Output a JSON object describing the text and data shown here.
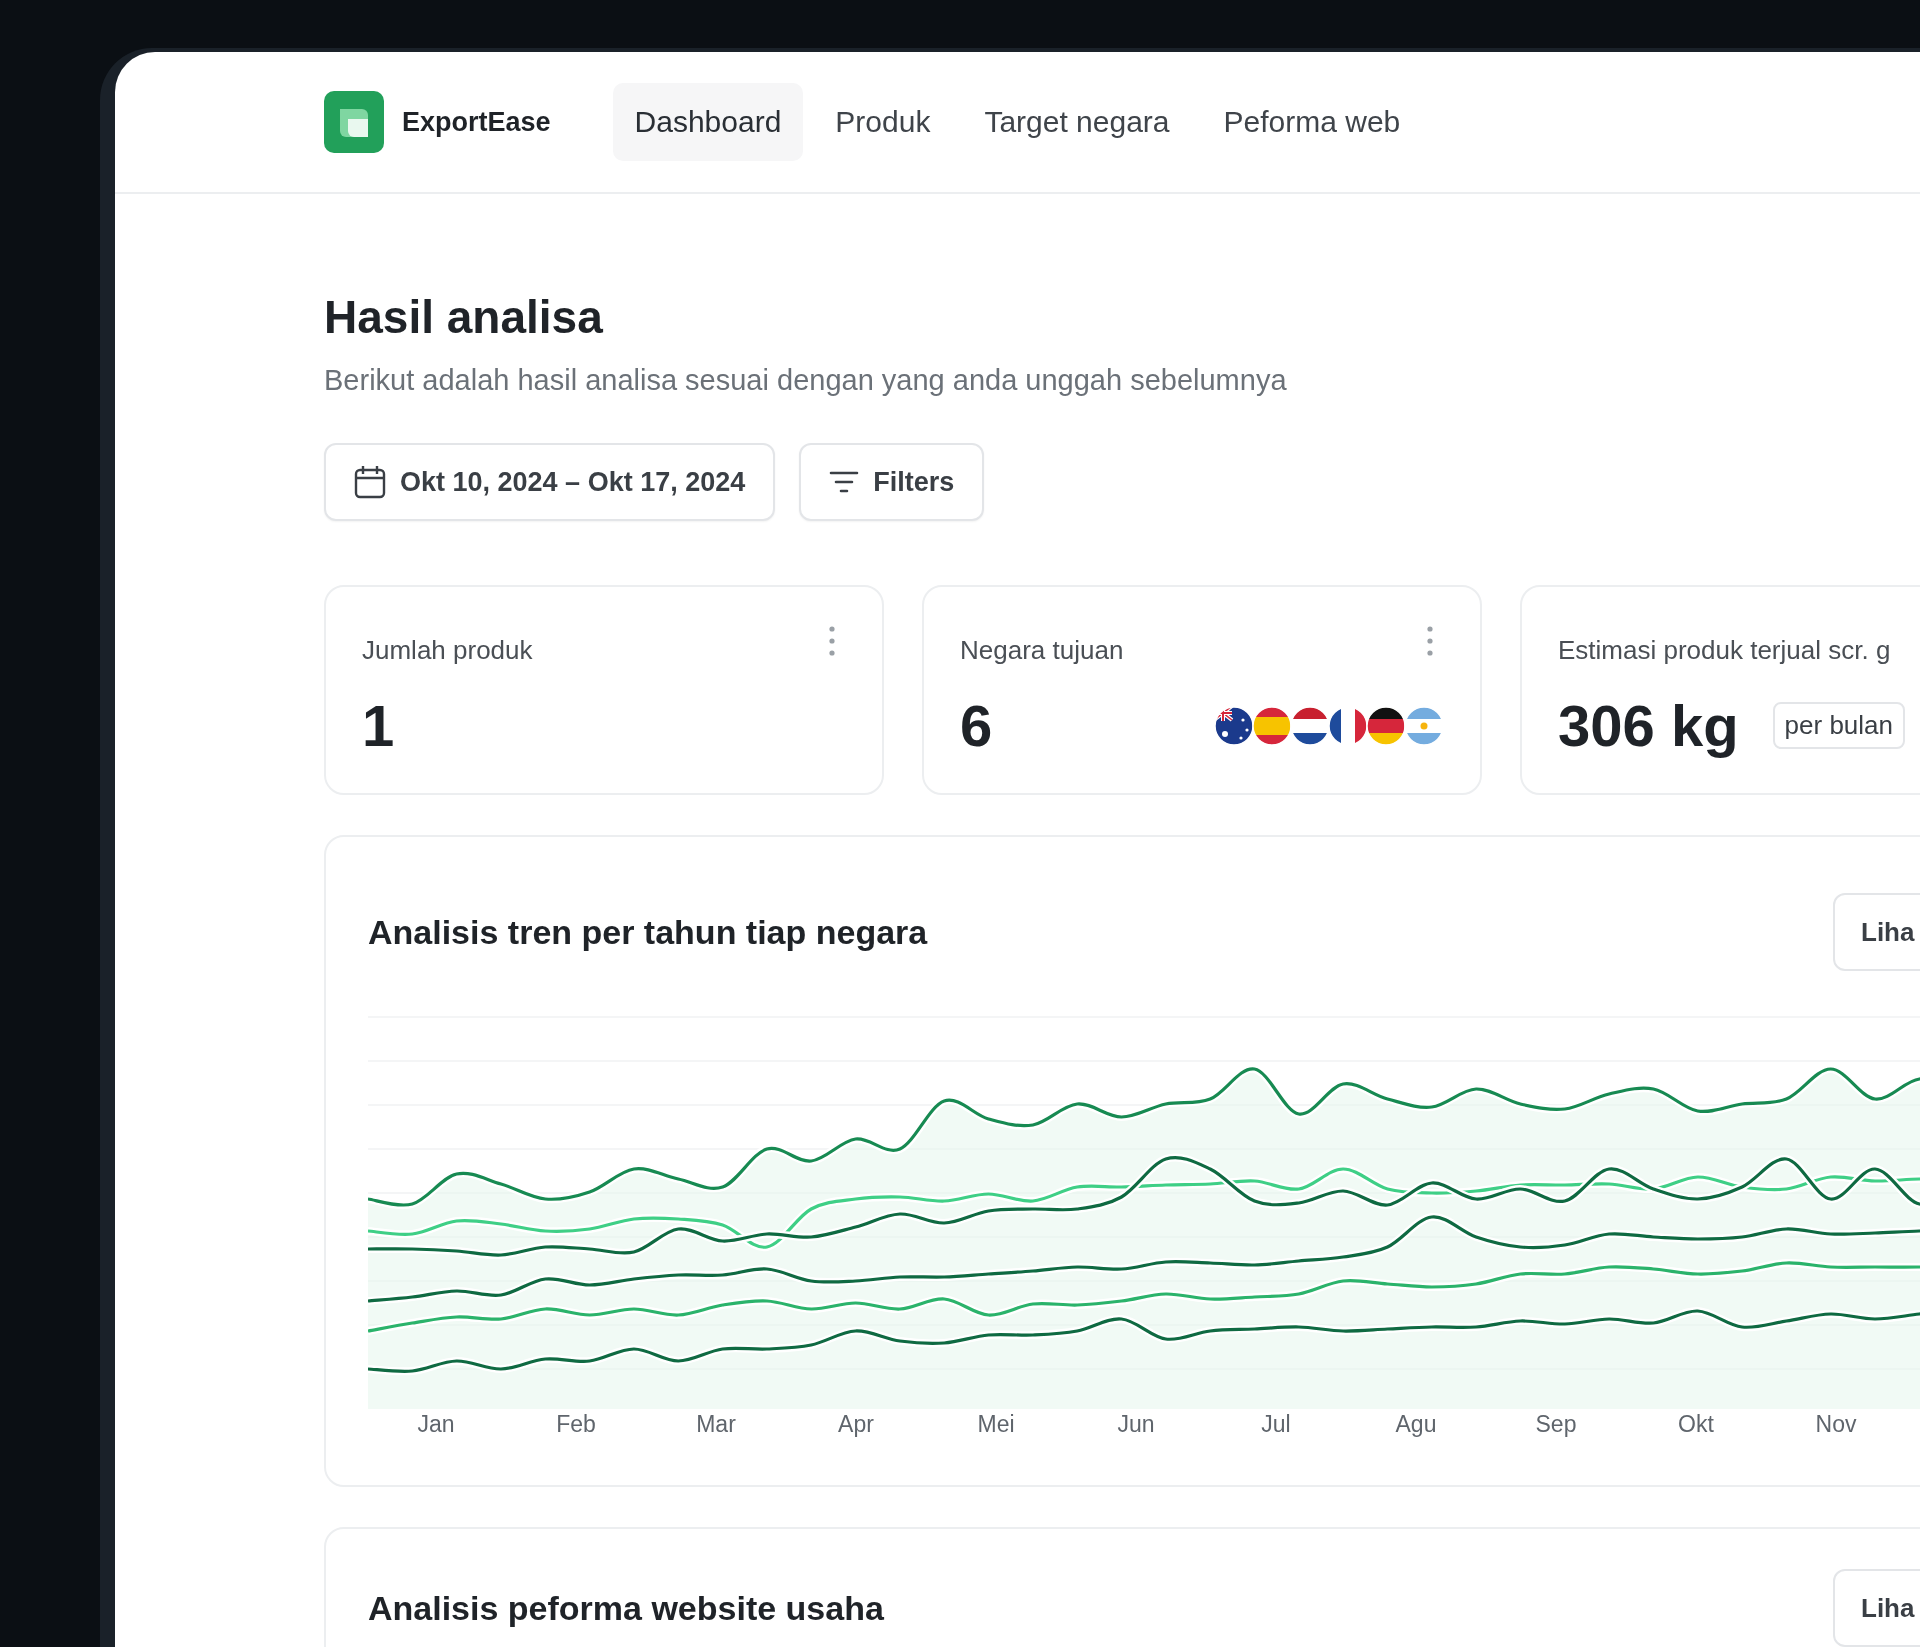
{
  "brand": {
    "name": "ExportEase"
  },
  "nav": [
    {
      "label": "Dashboard",
      "selected": true
    },
    {
      "label": "Produk",
      "selected": false
    },
    {
      "label": "Target negara",
      "selected": false
    },
    {
      "label": "Peforma web",
      "selected": false
    }
  ],
  "page": {
    "title": "Hasil analisa",
    "subtitle": "Berikut adalah hasil analisa sesuai dengan yang anda unggah sebelumnya"
  },
  "toolbar": {
    "date_range": "Okt 10, 2024 – Okt 17, 2024",
    "filters": "Filters"
  },
  "stats": [
    {
      "kind": "plain",
      "label": "Jumlah produk",
      "value": "1"
    },
    {
      "kind": "flags",
      "label": "Negara tujuan",
      "value": "6",
      "flags": [
        {
          "kind": "au"
        },
        {
          "kind": "es"
        },
        {
          "kind": "nl"
        },
        {
          "kind": "fr"
        },
        {
          "kind": "de"
        },
        {
          "kind": "ar"
        }
      ]
    },
    {
      "kind": "unit",
      "label": "Estimasi produk terjual scr. g",
      "value": "306 kg",
      "unit": "per bulan"
    }
  ],
  "trend_card": {
    "title": "Analisis tren per tahun tiap negara",
    "button": "Liha",
    "x_labels": [
      "Jan",
      "Feb",
      "Mar",
      "Apr",
      "Mei",
      "Jun",
      "Jul",
      "Agu",
      "Sep",
      "Okt",
      "Nov"
    ]
  },
  "web_card": {
    "title": "Analisis peforma website usaha",
    "button": "Liha"
  }
}
